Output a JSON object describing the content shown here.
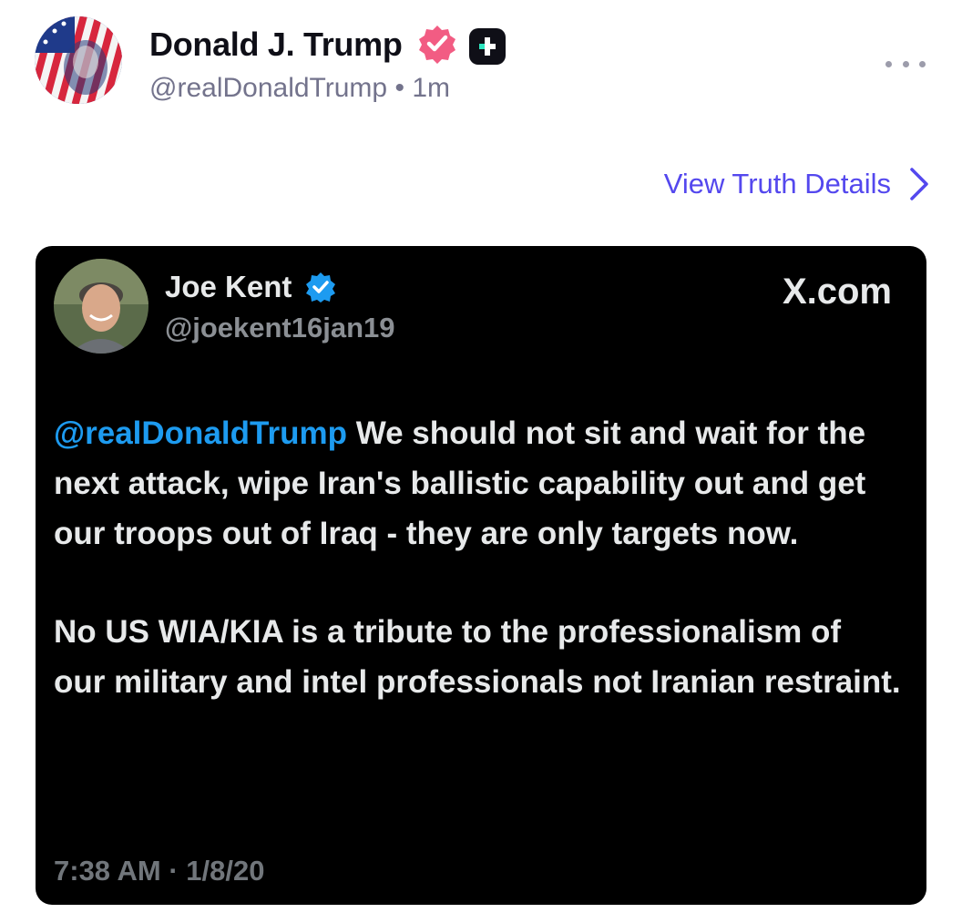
{
  "post": {
    "author_name": "Donald J. Trump",
    "handle": "@realDonaldTrump",
    "separator": "•",
    "time": "1m",
    "view_details_label": "View Truth Details",
    "icons": {
      "avatar": "avatar-flag-portrait",
      "verified": "verified-badge-icon",
      "plus": "plus-badge-icon",
      "more": "more-options-icon",
      "chevron": "chevron-right-icon"
    }
  },
  "embed": {
    "author_name": "Joe Kent",
    "handle": "@joekent16jan19",
    "source_logo": "X.com",
    "mention": "@realDonaldTrump",
    "paragraph1": " We should not sit and wait for the next attack, wipe Iran's ballistic capability out and get our troops out of Iraq - they are only targets now.",
    "paragraph2": "No US WIA/KIA is a tribute to the professionalism of our military and intel professionals not Iranian restraint.",
    "timestamp": "7:38 AM · 1/8/20"
  },
  "colors": {
    "link": "#5448ee",
    "verified_pink": "#f25c83",
    "x_verified": "#1d9bf0",
    "mention": "#1d9bf0",
    "embed_bg": "#000000"
  }
}
